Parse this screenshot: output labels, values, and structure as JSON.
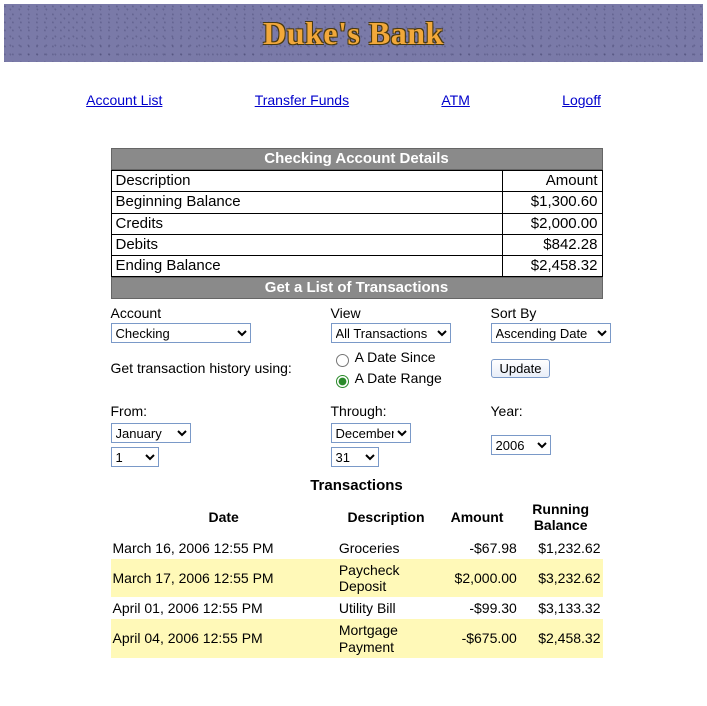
{
  "banner": {
    "title": "Duke's Bank"
  },
  "nav": {
    "account_list": "Account List",
    "transfer_funds": "Transfer Funds",
    "atm": "ATM",
    "logoff": "Logoff"
  },
  "details": {
    "title": "Checking Account Details",
    "header_desc": "Description",
    "header_amt": "Amount",
    "rows": [
      {
        "label": "Beginning Balance",
        "amount": "$1,300.60"
      },
      {
        "label": "Credits",
        "amount": "$2,000.00"
      },
      {
        "label": "Debits",
        "amount": "$842.28"
      },
      {
        "label": "Ending Balance",
        "amount": "$2,458.32"
      }
    ]
  },
  "filter": {
    "title": "Get a List of Transactions",
    "account_label": "Account",
    "account_value": "Checking",
    "view_label": "View",
    "view_value": "All Transactions",
    "sort_label": "Sort By",
    "sort_value": "Ascending Date",
    "history_label": "Get transaction history using:",
    "radio_since": "A Date Since",
    "radio_range": "A Date Range",
    "update_label": "Update",
    "from_label": "From:",
    "through_label": "Through:",
    "year_label": "Year:",
    "from_month": "January",
    "from_day": "1",
    "through_month": "December",
    "through_day": "31",
    "year_value": "2006"
  },
  "tx": {
    "title": "Transactions",
    "col_date": "Date",
    "col_desc": "Description",
    "col_amt": "Amount",
    "col_bal": "Running Balance",
    "rows": [
      {
        "date": "March 16, 2006 12:55 PM",
        "desc": "Groceries",
        "amt": "-$67.98",
        "bal": "$1,232.62",
        "hl": false
      },
      {
        "date": "March 17, 2006 12:55 PM",
        "desc": "Paycheck Deposit",
        "amt": "$2,000.00",
        "bal": "$3,232.62",
        "hl": true
      },
      {
        "date": "April 01, 2006 12:55 PM",
        "desc": "Utility Bill",
        "amt": "-$99.30",
        "bal": "$3,133.32",
        "hl": false
      },
      {
        "date": "April 04, 2006 12:55 PM",
        "desc": "Mortgage Payment",
        "amt": "-$675.00",
        "bal": "$2,458.32",
        "hl": true
      }
    ]
  }
}
